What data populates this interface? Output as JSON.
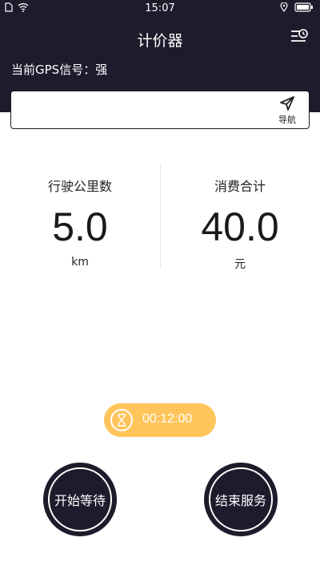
{
  "status_bar": {
    "time": "15:07",
    "left_icons": [
      "sim-icon",
      "wifi-icon"
    ],
    "right_icons": [
      "location-icon",
      "battery-icon"
    ]
  },
  "header": {
    "title": "计价器",
    "gps_label": "当前GPS信号：强",
    "background": "#1c1c2c"
  },
  "navigation": {
    "input_value": "",
    "nav_label": "导航"
  },
  "stats": {
    "distance": {
      "label": "行驶公里数",
      "value": "5.0",
      "unit": "km"
    },
    "cost": {
      "label": "消费合计",
      "value": "40.0",
      "unit": "元"
    }
  },
  "timer": {
    "value": "00:12:00",
    "color": "#ffc45a"
  },
  "buttons": {
    "start_wait": "开始等待",
    "end_service": "结束服务"
  }
}
